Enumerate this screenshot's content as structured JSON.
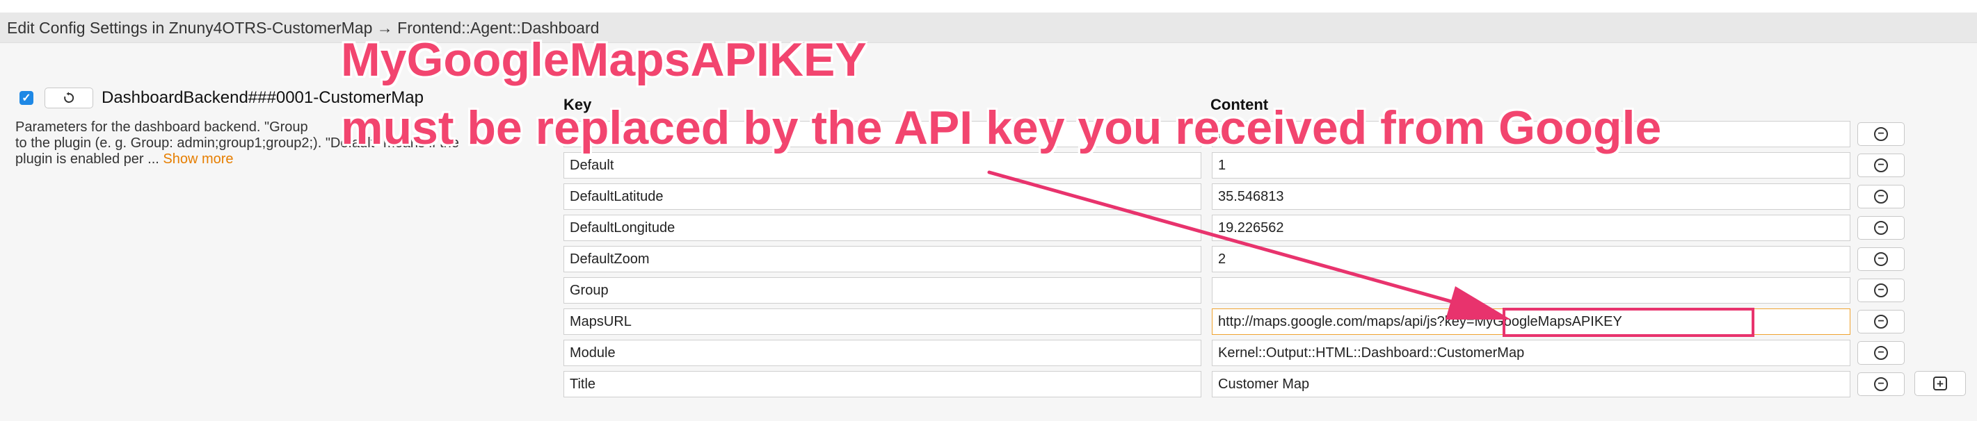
{
  "header": {
    "title": "Edit Config Settings in Znuny4OTRS-CustomerMap → Frontend::Agent::Dashboard"
  },
  "setting": {
    "checked": true,
    "name": "DashboardBackend###0001-CustomerMap",
    "reset_icon": "reset-icon",
    "description_line1": "Parameters for the dashboard backend. \"Group",
    "description_line2": "to the plugin (e. g. Group: admin;group1;group2;). \"Default\" means if the",
    "description_line3": "plugin is enabled per ...",
    "show_more": "Show more"
  },
  "table": {
    "key_header": "Key",
    "content_header": "Content",
    "rows": [
      {
        "key": "",
        "value": "nt"
      },
      {
        "key": "Default",
        "value": "1"
      },
      {
        "key": "DefaultLatitude",
        "value": "35.546813"
      },
      {
        "key": "DefaultLongitude",
        "value": "19.226562"
      },
      {
        "key": "DefaultZoom",
        "value": "2"
      },
      {
        "key": "Group",
        "value": ""
      },
      {
        "key": "MapsURL",
        "value": "http://maps.google.com/maps/api/js?key=MyGoogleMapsAPIKEY"
      },
      {
        "key": "Module",
        "value": "Kernel::Output::HTML::Dashboard::CustomerMap"
      },
      {
        "key": "Title",
        "value": "Customer Map"
      }
    ],
    "remove_icon": "minus-icon",
    "add_icon": "plus-icon"
  },
  "annotation": {
    "line1": "MyGoogleMapsAPIKEY",
    "line2": "must be replaced by the API key you received from Google",
    "color": "#f2456f"
  }
}
